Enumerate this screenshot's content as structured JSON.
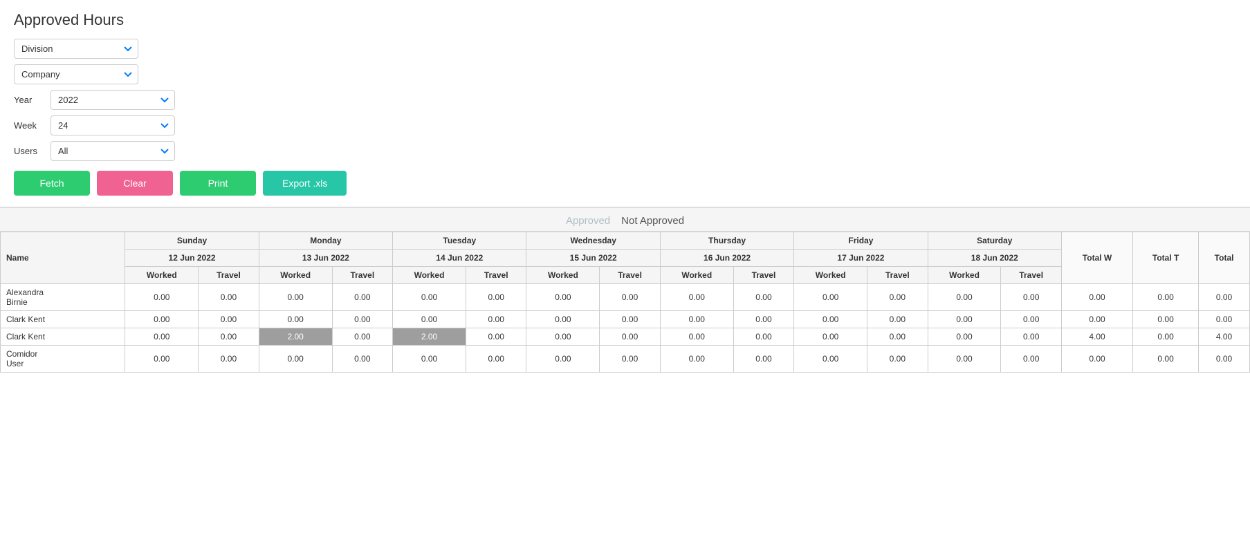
{
  "page": {
    "title": "Approved Hours"
  },
  "filters": {
    "division_label": "Division",
    "company_label": "Company",
    "year_label": "Year",
    "week_label": "Week",
    "users_label": "Users",
    "year_value": "2022",
    "week_value": "24",
    "users_value": "All"
  },
  "buttons": {
    "fetch": "Fetch",
    "clear": "Clear",
    "print": "Print",
    "export": "Export .xls"
  },
  "legend": {
    "approved": "Approved",
    "not_approved": "Not Approved"
  },
  "table": {
    "days": [
      {
        "name": "Sunday",
        "date": "12 Jun 2022"
      },
      {
        "name": "Monday",
        "date": "13 Jun 2022"
      },
      {
        "name": "Tuesday",
        "date": "14 Jun 2022"
      },
      {
        "name": "Wednesday",
        "date": "15 Jun 2022"
      },
      {
        "name": "Thursday",
        "date": "16 Jun 2022"
      },
      {
        "name": "Friday",
        "date": "17 Jun 2022"
      },
      {
        "name": "Saturday",
        "date": "18 Jun 2022"
      }
    ],
    "sub_cols": [
      "Worked",
      "Travel"
    ],
    "totals_cols": [
      "Total W",
      "Total T",
      "Total"
    ],
    "rows": [
      {
        "name": "Alexandra\nBirnie",
        "values": [
          "0.00",
          "0.00",
          "0.00",
          "0.00",
          "0.00",
          "0.00",
          "0.00",
          "0.00",
          "0.00",
          "0.00",
          "0.00",
          "0.00",
          "0.00",
          "0.00"
        ],
        "totals": [
          "0.00",
          "0.00",
          "0.00"
        ],
        "gray_cells": []
      },
      {
        "name": "Clark Kent",
        "values": [
          "0.00",
          "0.00",
          "0.00",
          "0.00",
          "0.00",
          "0.00",
          "0.00",
          "0.00",
          "0.00",
          "0.00",
          "0.00",
          "0.00",
          "0.00",
          "0.00"
        ],
        "totals": [
          "0.00",
          "0.00",
          "0.00"
        ],
        "gray_cells": []
      },
      {
        "name": "Clark Kent",
        "values": [
          "0.00",
          "0.00",
          "2.00",
          "0.00",
          "2.00",
          "0.00",
          "0.00",
          "0.00",
          "0.00",
          "0.00",
          "0.00",
          "0.00",
          "0.00",
          "0.00"
        ],
        "totals": [
          "4.00",
          "0.00",
          "4.00"
        ],
        "gray_cells": [
          2,
          4
        ]
      },
      {
        "name": "Comidor\nUser",
        "values": [
          "0.00",
          "0.00",
          "0.00",
          "0.00",
          "0.00",
          "0.00",
          "0.00",
          "0.00",
          "0.00",
          "0.00",
          "0.00",
          "0.00",
          "0.00",
          "0.00"
        ],
        "totals": [
          "0.00",
          "0.00",
          "0.00"
        ],
        "gray_cells": []
      }
    ]
  }
}
